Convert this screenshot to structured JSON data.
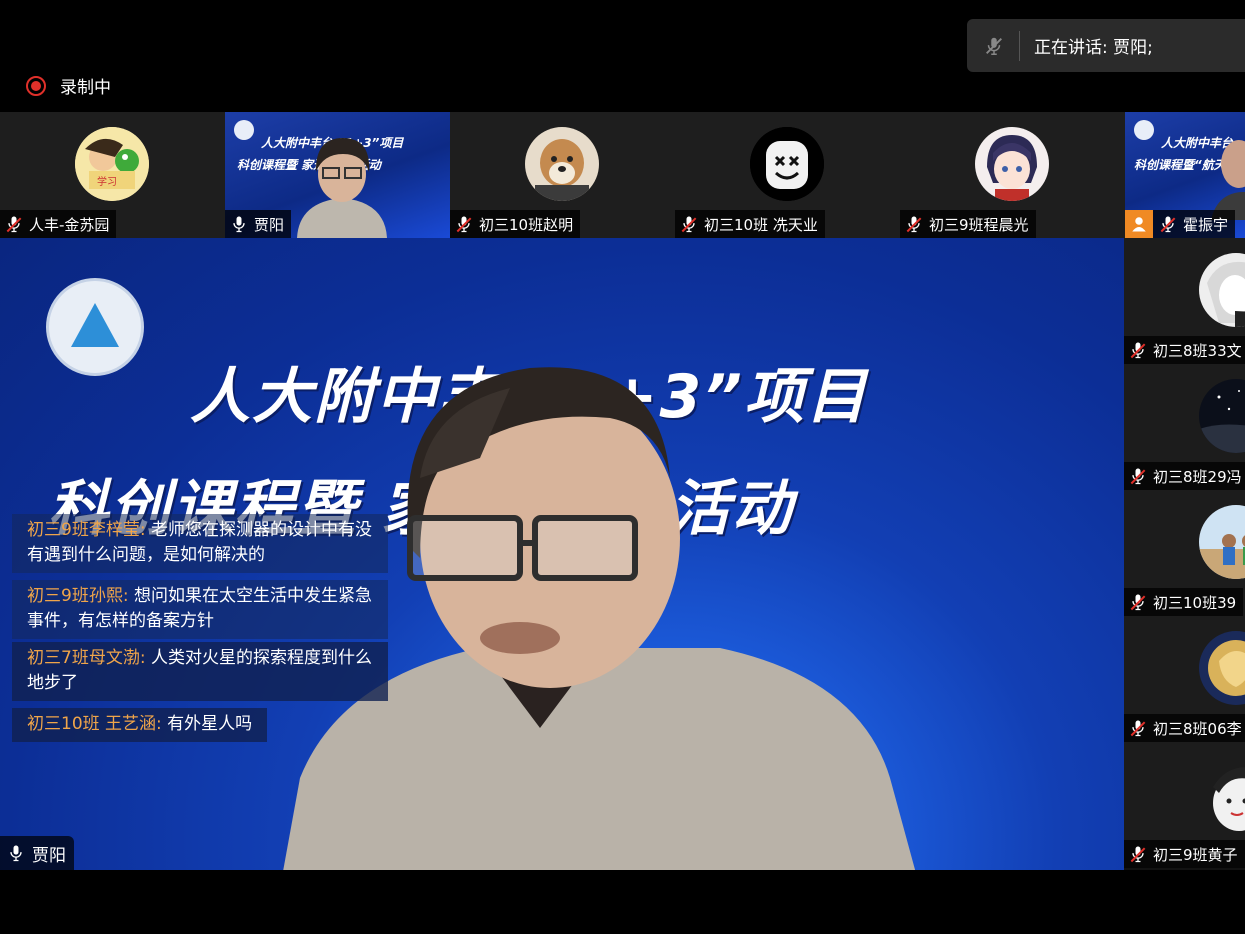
{
  "recording": {
    "label": "录制中"
  },
  "speaking": {
    "label": "正在讲话: 贾阳;"
  },
  "strip": [
    {
      "name": "人丰-金苏园",
      "mic": "muted"
    },
    {
      "name": "贾阳",
      "mic": "on",
      "slide_line1": "人大附中丰台  “1+3”项目",
      "slide_line2": "科创课程暨        家进校园”活动"
    },
    {
      "name": "初三10班赵明",
      "mic": "muted"
    },
    {
      "name": "初三10班 冼天业",
      "mic": "muted"
    },
    {
      "name": "初三9班程晨光",
      "mic": "muted"
    },
    {
      "name": "霍振宇",
      "mic": "muted",
      "slide_line1": "人大附中丰台",
      "slide_line2": "科创课程暨“航天"
    }
  ],
  "main": {
    "slide_title1": "人大附中丰       “1+3”项目",
    "slide_title2": "科创课程暨              家进校园”活动",
    "speaker_label": "贾阳"
  },
  "chat": [
    {
      "who": "初三9班李梓莹:",
      "text": "老师您在探测器的设计中有没有遇到什么问题，是如何解决的"
    },
    {
      "who": "初三9班孙熙:",
      "text": "想问如果在太空生活中发生紧急事件，有怎样的备案方针"
    },
    {
      "who": "初三7班母文渤:",
      "text": "人类对火星的探索程度到什么地步了"
    },
    {
      "who": "初三10班 王艺涵:",
      "text": "有外星人吗"
    }
  ],
  "right": [
    {
      "name": "初三8班33文"
    },
    {
      "name": "初三8班29冯"
    },
    {
      "name": "初三10班39"
    },
    {
      "name": "初三8班06李"
    },
    {
      "name": "初三9班黄子"
    }
  ],
  "colors": {
    "accent_name": "#f0a54a",
    "recording": "#e0302a",
    "mute_red": "#e0302a"
  }
}
